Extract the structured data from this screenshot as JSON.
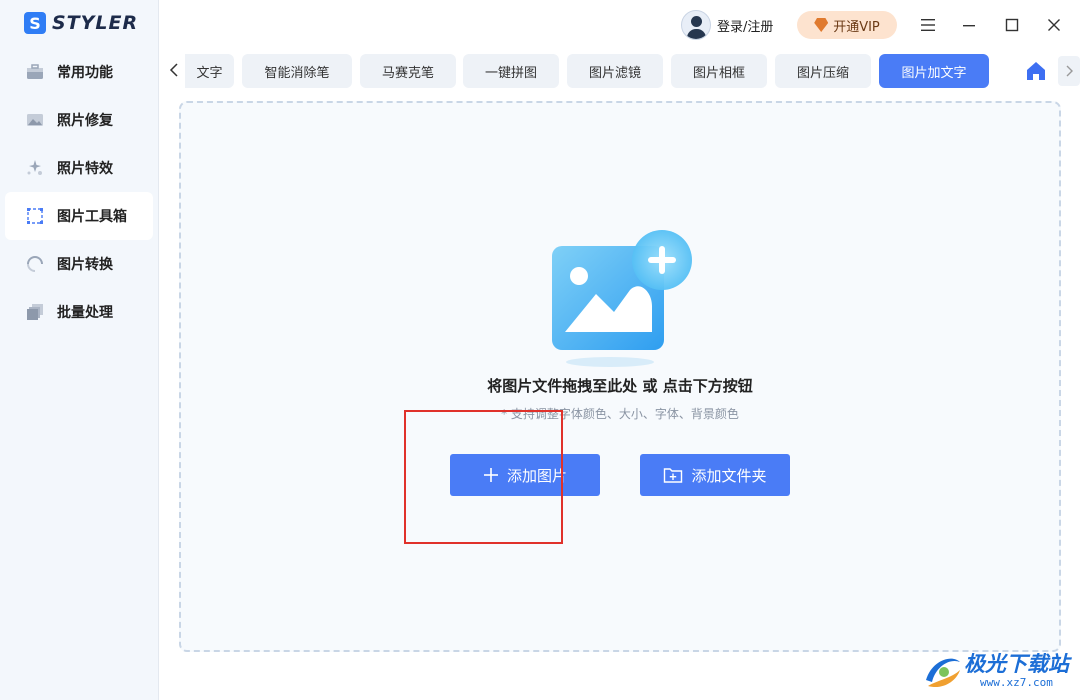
{
  "app": {
    "logo_letter": "S",
    "name": "STYLER"
  },
  "sidebar": {
    "items": [
      {
        "label": "常用功能",
        "icon": "toolbox-icon"
      },
      {
        "label": "照片修复",
        "icon": "photo-repair-icon"
      },
      {
        "label": "照片特效",
        "icon": "sparkle-effects-icon"
      },
      {
        "label": "图片工具箱",
        "icon": "crop-frame-icon",
        "active": true
      },
      {
        "label": "图片转换",
        "icon": "convert-icon"
      },
      {
        "label": "批量处理",
        "icon": "batch-icon"
      }
    ]
  },
  "titlebar": {
    "user_label": "登录/注册",
    "vip_label": "开通VIP"
  },
  "tabs": {
    "items": [
      {
        "label": "文字"
      },
      {
        "label": "智能消除笔"
      },
      {
        "label": "马赛克笔"
      },
      {
        "label": "一键拼图"
      },
      {
        "label": "图片滤镜"
      },
      {
        "label": "图片相框"
      },
      {
        "label": "图片压缩"
      },
      {
        "label": "图片加文字",
        "active": true
      }
    ]
  },
  "dropzone": {
    "title": "将图片文件拖拽至此处 或 点击下方按钮",
    "subtitle": "* 支持调整字体颜色、大小、字体、背景颜色",
    "add_image_label": "添加图片",
    "add_folder_label": "添加文件夹"
  },
  "watermark": {
    "text": "极光下载站",
    "url": "www.xz7.com"
  },
  "colors": {
    "accent": "#4a7cf6",
    "sidebar_bg": "#f3f7fc",
    "vip_bg": "#fde3cf",
    "highlight_box": "#e0312b"
  }
}
